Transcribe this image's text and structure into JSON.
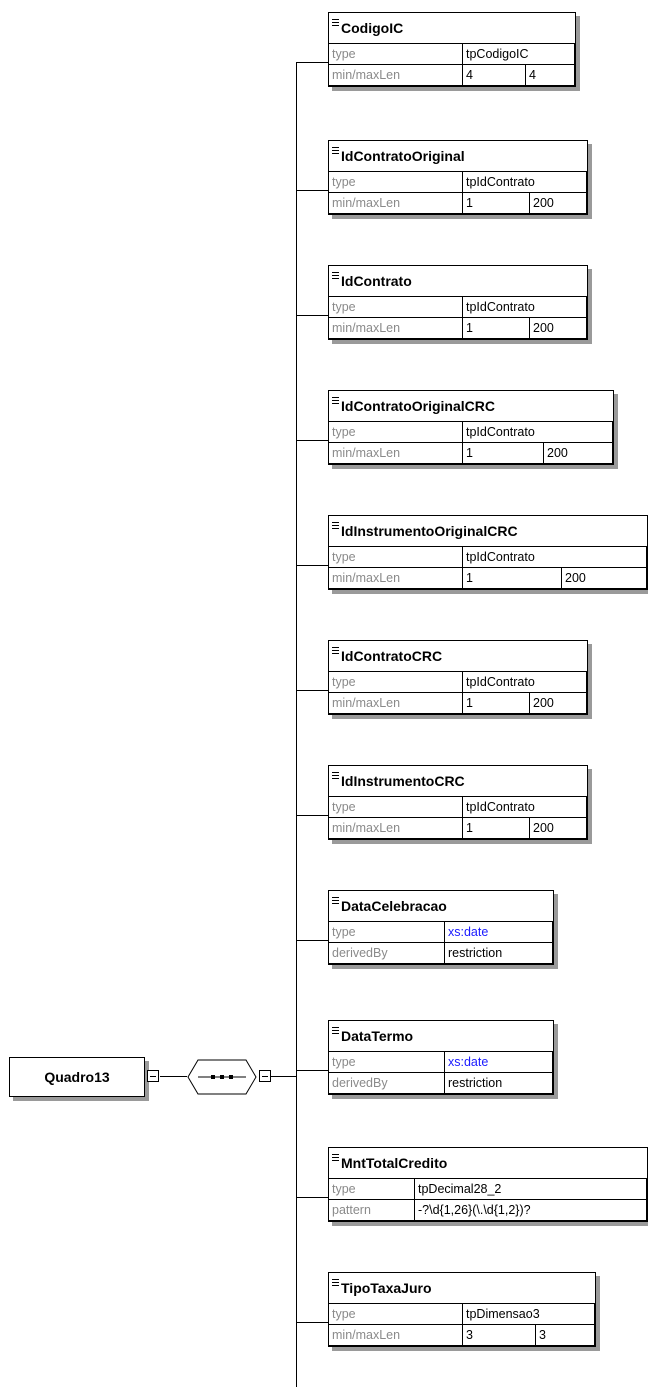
{
  "root": {
    "label": "Quadro13"
  },
  "sequence": {
    "icon": "sequence-compositor-icon"
  },
  "icons": {
    "element": "element-marker-icon",
    "expander": "minus-toggle-icon"
  },
  "colors": {
    "builtin_type": "#1a1aff",
    "key_text": "#8a8a8a",
    "shadow": "#9a9a9a"
  },
  "elements": [
    {
      "name": "CodigoIC",
      "type_key": "type",
      "type": "tpCodigoIC",
      "rest_key": "min/maxLen",
      "min": "4",
      "max": "4"
    },
    {
      "name": "IdContratoOriginal",
      "type_key": "type",
      "type": "tpIdContrato",
      "rest_key": "min/maxLen",
      "min": "1",
      "max": "200"
    },
    {
      "name": "IdContrato",
      "type_key": "type",
      "type": "tpIdContrato",
      "rest_key": "min/maxLen",
      "min": "1",
      "max": "200"
    },
    {
      "name": "IdContratoOriginalCRC",
      "type_key": "type",
      "type": "tpIdContrato",
      "rest_key": "min/maxLen",
      "min": "1",
      "max": "200"
    },
    {
      "name": "IdInstrumentoOriginalCRC",
      "type_key": "type",
      "type": "tpIdContrato",
      "rest_key": "min/maxLen",
      "min": "1",
      "max": "200"
    },
    {
      "name": "IdContratoCRC",
      "type_key": "type",
      "type": "tpIdContrato",
      "rest_key": "min/maxLen",
      "min": "1",
      "max": "200"
    },
    {
      "name": "IdInstrumentoCRC",
      "type_key": "type",
      "type": "tpIdContrato",
      "rest_key": "min/maxLen",
      "min": "1",
      "max": "200"
    },
    {
      "name": "DataCelebracao",
      "type_key": "type",
      "type": "xs:date",
      "rest_key": "derivedBy",
      "value": "restriction"
    },
    {
      "name": "DataTermo",
      "type_key": "type",
      "type": "xs:date",
      "rest_key": "derivedBy",
      "value": "restriction"
    },
    {
      "name": "MntTotalCredito",
      "type_key": "type",
      "type": "tpDecimal28_2",
      "rest_key": "pattern",
      "value": "-?\\d{1,26}(\\.\\d{1,2})?"
    },
    {
      "name": "TipoTaxaJuro",
      "type_key": "type",
      "type": "tpDimensao3",
      "rest_key": "min/maxLen",
      "min": "3",
      "max": "3"
    }
  ]
}
